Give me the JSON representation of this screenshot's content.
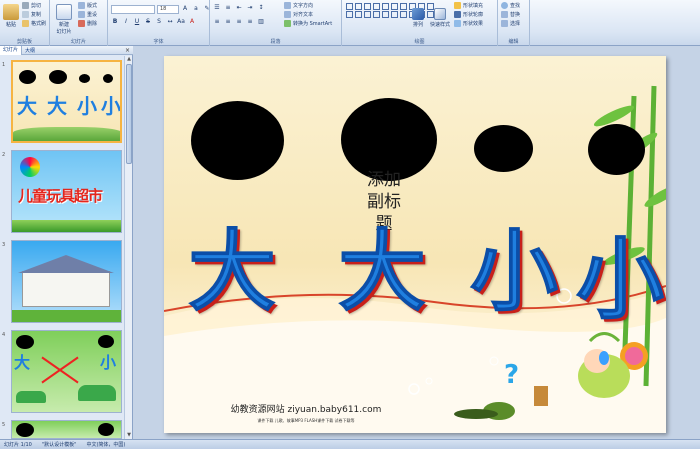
{
  "ribbon": {
    "groups": [
      {
        "label": "剪贴板"
      },
      {
        "label": "幻灯片"
      },
      {
        "label": "字体"
      },
      {
        "label": "段落"
      },
      {
        "label": "绘图"
      },
      {
        "label": "编辑"
      }
    ],
    "clipboard": {
      "paste": "粘贴",
      "cut": "剪切",
      "copy": "复制",
      "format_painter": "格式刷"
    },
    "slides": {
      "new_slide": "新建\n幻灯片",
      "layout": "版式",
      "reset": "重设",
      "delete": "删除"
    },
    "font": {
      "font_name": "",
      "font_size": "18"
    },
    "paragraph": {
      "text_direction": "文字方向",
      "align_text": "对齐文本",
      "smartart": "转换为 SmartArt"
    },
    "drawing": {
      "arrange": "排列",
      "quick_styles": "快速样式",
      "shape_fill": "形状填充",
      "shape_outline": "形状轮廓",
      "shape_effects": "形状效果"
    },
    "editing": {
      "find": "查找",
      "replace": "替换",
      "select": "选择"
    }
  },
  "left_pane": {
    "tabs": [
      "幻灯片",
      "大纲"
    ],
    "close": "×",
    "thumbnails": [
      {
        "num": "1",
        "chars": [
          "大",
          "大",
          "小",
          "小"
        ]
      },
      {
        "num": "2",
        "title": "儿童玩具超市"
      },
      {
        "num": "3"
      },
      {
        "num": "4",
        "chars": [
          "大",
          "小"
        ]
      },
      {
        "num": "5"
      }
    ]
  },
  "slide": {
    "chars": [
      "大",
      "大",
      "小",
      "小"
    ],
    "subtitle": "添加副标题",
    "website": "幼教资源网站  ziyuan.baby611.com",
    "website_sub": "课件下载    儿歌、故事MP3    FLASH课件下载    试卷下载等"
  },
  "statusbar": {
    "slide_indicator": "幻灯片 1/10",
    "theme": "\"默认设计模板\"",
    "language": "中文(简体，中国)"
  },
  "colors": {
    "accent": "#1f7fe0",
    "ribbon": "#dbe6f4",
    "selected": "#f6b442"
  }
}
